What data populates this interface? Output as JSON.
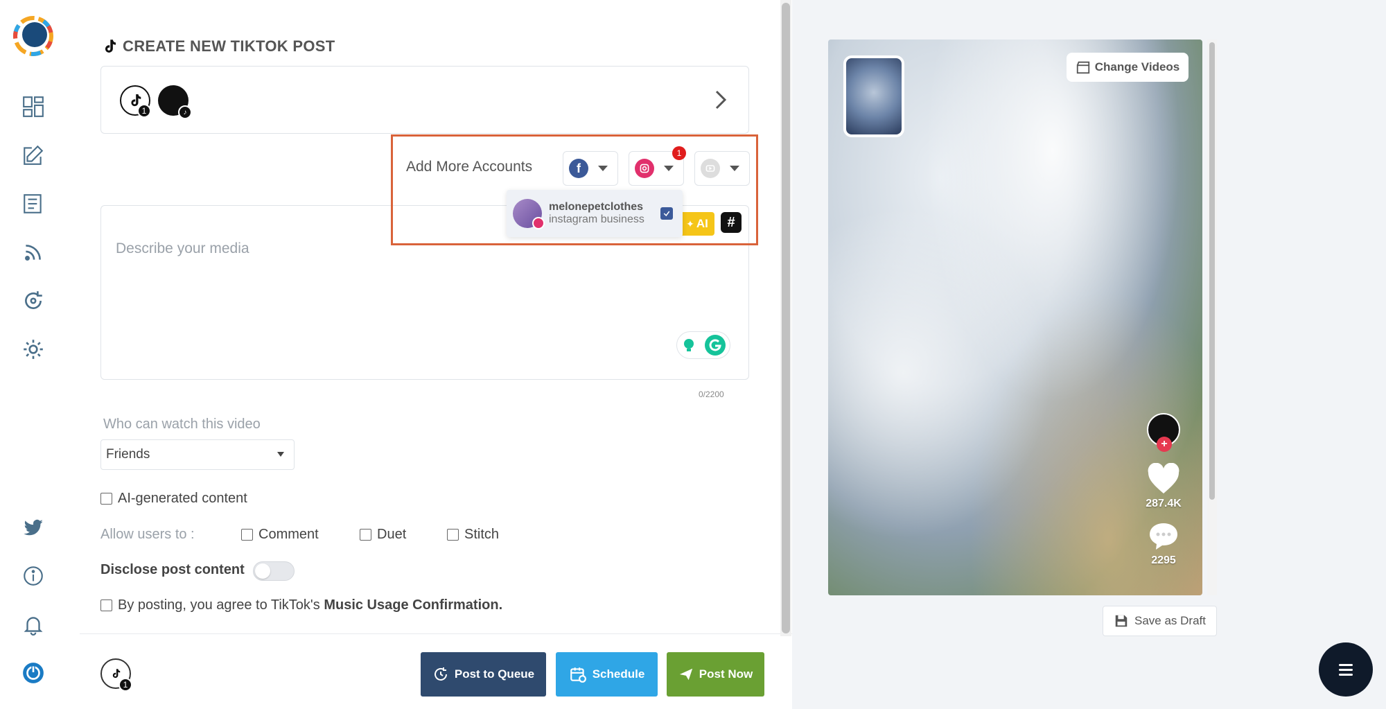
{
  "page": {
    "title": "CREATE NEW TIKTOK POST"
  },
  "sidebar": {
    "items": [
      {
        "name": "dashboard-icon"
      },
      {
        "name": "compose-icon"
      },
      {
        "name": "posts-icon"
      },
      {
        "name": "rss-icon"
      },
      {
        "name": "recycle-icon"
      },
      {
        "name": "settings-icon"
      },
      {
        "name": "twitter-icon"
      },
      {
        "name": "info-icon"
      },
      {
        "name": "bell-icon"
      },
      {
        "name": "power-icon"
      }
    ]
  },
  "accounts": {
    "selected_count": "1"
  },
  "add_more": {
    "label": "Add More Accounts",
    "instagram_badge": "1",
    "dropdown": {
      "account_name": "melonepetclothes",
      "account_type": "instagram business",
      "checked": true
    }
  },
  "composer": {
    "placeholder": "Describe your media",
    "ai_label": "AI",
    "hashtag_label": "#",
    "char_count": "0/2200"
  },
  "privacy": {
    "label": "Who can watch this video",
    "selected": "Friends"
  },
  "options": {
    "ai_generated": "AI-generated content",
    "allow_label": "Allow users to :",
    "comment": "Comment",
    "duet": "Duet",
    "stitch": "Stitch",
    "disclose": "Disclose post content",
    "agree_prefix": "By posting, you agree to TikTok's ",
    "agree_link": "Music Usage Confirmation."
  },
  "footer": {
    "account_count": "1",
    "post_queue": "Post to Queue",
    "schedule": "Schedule",
    "post_now": "Post Now",
    "colors": {
      "queue": "#2f4a6e",
      "schedule": "#2fa6e6",
      "post_now": "#6aa033"
    }
  },
  "preview": {
    "change_videos": "Change Videos",
    "likes": "287.4K",
    "comments": "2295",
    "save_draft": "Save as Draft"
  }
}
